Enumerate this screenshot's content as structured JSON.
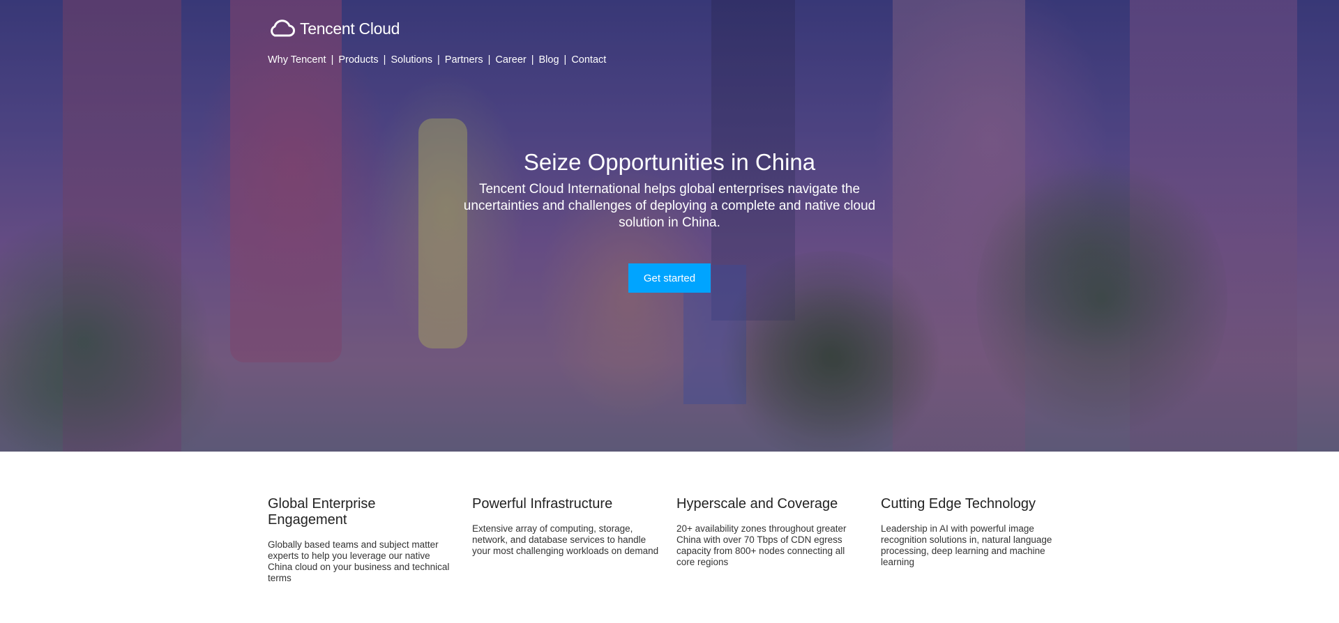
{
  "brand": {
    "logo_icon": "cloud-icon",
    "name": "Tencent Cloud"
  },
  "nav": {
    "items": [
      "Why Tencent",
      "Products",
      "Solutions",
      "Partners",
      "Career",
      "Blog",
      "Contact"
    ],
    "separator": "|"
  },
  "hero": {
    "title": "Seize Opportunities in China",
    "subtitle": "Tencent Cloud International helps global enterprises navigate the uncertainties and challenges of deploying a complete and native cloud solution in China.",
    "cta_label": "Get started",
    "cta_color": "#00a4ff"
  },
  "features": [
    {
      "title": "Global Enterprise Engagement",
      "text": "Globally based teams and subject matter experts to help you leverage our native China cloud on your business and technical terms"
    },
    {
      "title": "Powerful Infrastructure",
      "text": "Extensive array of computing, storage, network, and database services to handle your most challenging workloads on demand"
    },
    {
      "title": "Hyperscale and Coverage",
      "text": "20+ availability zones throughout greater China with over 70 Tbps of CDN egress capacity from 800+ nodes connecting all core regions"
    },
    {
      "title": "Cutting Edge Technology",
      "text": "Leadership in AI with powerful image recognition solutions in, natural language processing, deep learning and machine learning"
    }
  ]
}
